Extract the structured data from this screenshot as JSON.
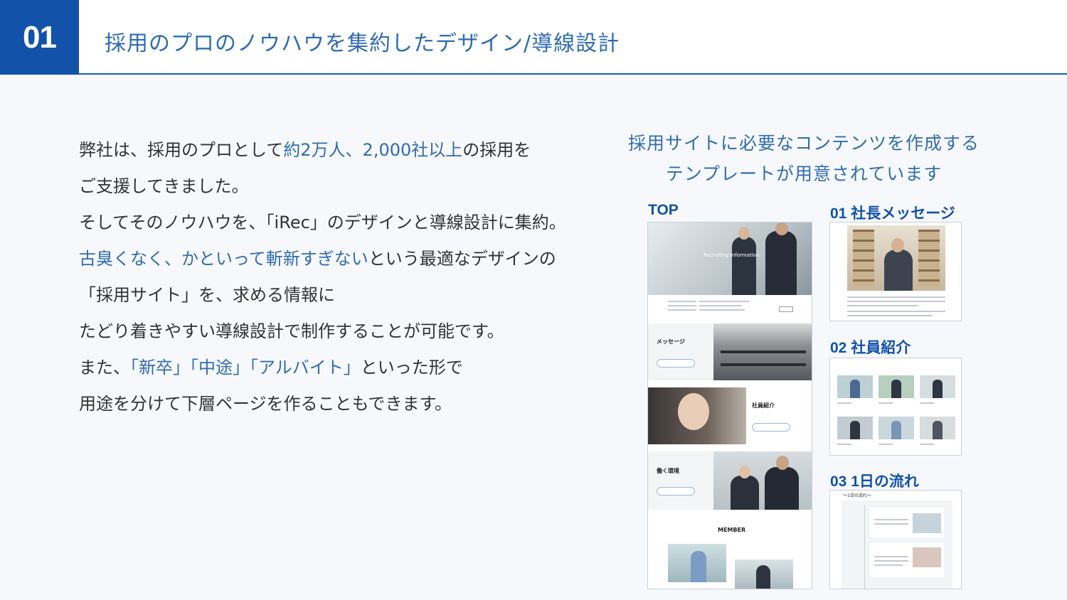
{
  "header": {
    "number": "01",
    "title": "採用のプロのノウハウを集約したデザイン/導線設計"
  },
  "body": {
    "lines": [
      [
        {
          "t": "弊社は、採用のプロとして",
          "hl": false
        },
        {
          "t": "約2万人、2,000社以上",
          "hl": true
        },
        {
          "t": "の採用を",
          "hl": false
        }
      ],
      [
        {
          "t": "ご支援してきました。",
          "hl": false
        }
      ],
      [
        {
          "t": "そしてそのノウハウを、「iRec」のデザインと導線設計に集約。",
          "hl": false
        }
      ],
      [
        {
          "t": "古臭くなく、かといって斬新すぎない",
          "hl": true
        },
        {
          "t": "という最適なデザインの",
          "hl": false
        }
      ],
      [
        {
          "t": "「採用サイト」を、求める情報に",
          "hl": false
        }
      ],
      [
        {
          "t": "たどり着きやすい導線設計で制作することが可能です。",
          "hl": false
        }
      ],
      [
        {
          "t": "また、",
          "hl": false
        },
        {
          "t": "「新卒」「中途」「アルバイト」",
          "hl": true
        },
        {
          "t": "といった形で",
          "hl": false
        }
      ],
      [
        {
          "t": "用途を分けて下層ページを作ることもできます。",
          "hl": false
        }
      ]
    ]
  },
  "right": {
    "heading_line1": "採用サイトに必要なコンテンツを作成する",
    "heading_line2": "テンプレートが用意されています",
    "top_label": "TOP",
    "s1_label": "01 社長メッセージ",
    "s2_label": "02 社員紹介",
    "s3_label": "03 1日の流れ",
    "mock": {
      "hero_text": "Recruiting Information",
      "message": "メッセージ",
      "staff": "社員紹介",
      "environment": "働く環境",
      "member": "MEMBER",
      "flow_title": "～1日の流れ～"
    }
  },
  "colors": {
    "accent": "#1252a8",
    "highlight": "#2f6cb0",
    "text": "#333333",
    "background": "#f7f8fc"
  }
}
